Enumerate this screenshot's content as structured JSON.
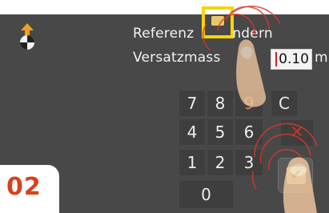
{
  "header": {
    "title": "Referenz verändern",
    "title_visible_left": "Referenz",
    "title_visible_right": "ndern"
  },
  "field": {
    "label": "Versatzmass",
    "value": "0.10",
    "unit": "m"
  },
  "keypad": {
    "rows": [
      [
        "7",
        "8",
        "9",
        "C"
      ],
      [
        "4",
        "5",
        "6"
      ],
      [
        "1",
        "2",
        "3"
      ],
      [
        "0"
      ]
    ]
  },
  "step": {
    "label": "02"
  },
  "colors": {
    "screen_bg": "#484848",
    "highlight": "#f7d30d",
    "step_text": "#d8401a",
    "delete": "#b33333"
  },
  "icons": {
    "app": "reference-marker-icon",
    "delete": "delete-x-icon",
    "confirm": "checkmark-icon",
    "touch": "finger-tap-icon"
  }
}
